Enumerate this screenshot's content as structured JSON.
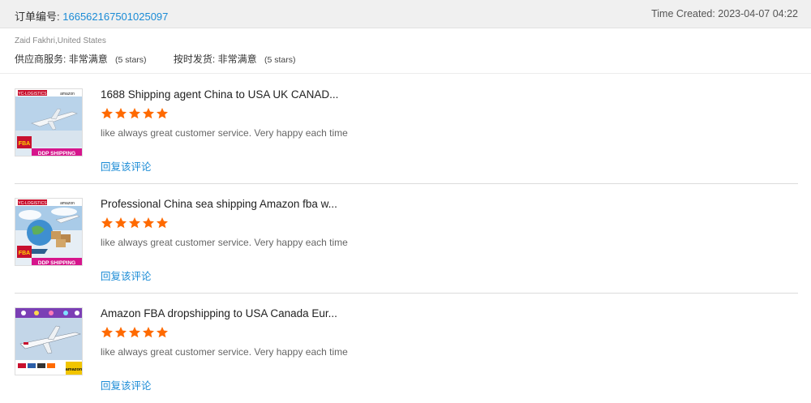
{
  "order": {
    "label": "订单编号:",
    "number": "166562167501025097",
    "time_created": "Time Created: 2023-04-07 04:22"
  },
  "buyer": {
    "name": "Zaid Fakhri,United States"
  },
  "seller_ratings": [
    {
      "label": "供应商服务:",
      "value": "非常满意",
      "note": "(5 stars)"
    },
    {
      "label": "按时发货:",
      "value": "非常满意",
      "note": "(5 stars)"
    }
  ],
  "reviews": [
    {
      "title": "1688 Shipping agent China to USA UK CANAD...",
      "rating": 5,
      "comment": "like always great customer service. Very happy each time",
      "reply_label": "回复该评论",
      "thumb": {
        "brand": "YC-LOGISTICS",
        "marketplace": "amazon",
        "badge": "FBA",
        "caption": "DDP SHIPPING"
      }
    },
    {
      "title": "Professional China sea shipping Amazon fba w...",
      "rating": 5,
      "comment": "like always great customer service. Very happy each time",
      "reply_label": "回复该评论",
      "thumb": {
        "brand": "YC-LOGISTICS",
        "marketplace": "amazon",
        "badge": "FBA",
        "caption": "DDP SHIPPING"
      }
    },
    {
      "title": "Amazon FBA dropshipping to USA Canada Eur...",
      "rating": 5,
      "comment": "like always great customer service. Very happy each time",
      "reply_label": "回复该评论",
      "thumb": {
        "marketplace": "amazon"
      }
    }
  ],
  "colors": {
    "link": "#1a8bd6",
    "star": "#ff6a00",
    "thumb_banner": "#c8102e",
    "thumb_caption_bg": "#d6158c"
  }
}
